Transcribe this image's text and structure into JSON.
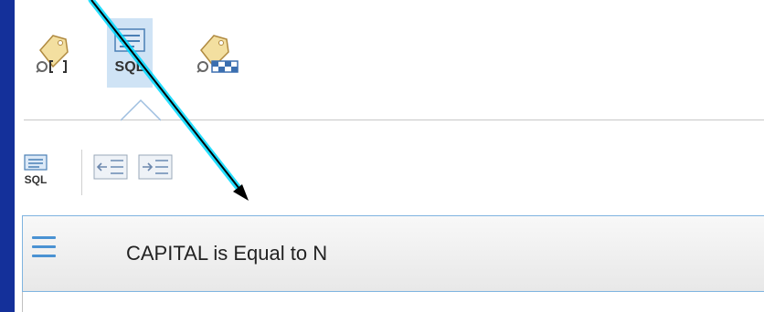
{
  "query_builder": {
    "modes": [
      {
        "name": "attribute-query",
        "icon": "tag-attribute-icon",
        "selected": false
      },
      {
        "name": "sql-query",
        "icon": "sql-icon",
        "label": "SQL",
        "selected": true
      },
      {
        "name": "spatial-query",
        "icon": "tag-spatial-icon",
        "selected": false
      }
    ],
    "toolbar": {
      "sql_icon_label": "SQL",
      "indent_left": "indent-left-icon",
      "indent_right": "indent-right-icon"
    },
    "clause": {
      "field": "CAPITAL",
      "operator": "is Equal to",
      "value": "N"
    }
  },
  "colors": {
    "frame": "#14309a",
    "accent": "#4a92d3",
    "selected_bg": "#cfe3f5",
    "annotation_arrow": "#000000",
    "annotation_glow": "#00d8ff"
  }
}
